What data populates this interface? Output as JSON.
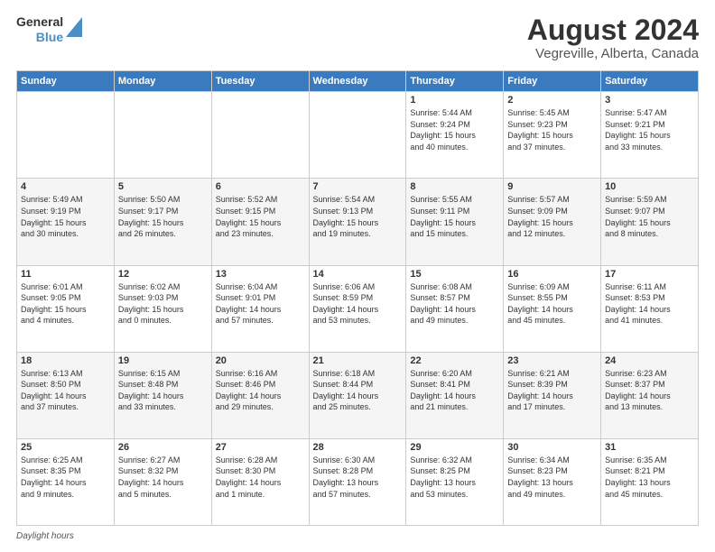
{
  "header": {
    "logo_line1": "General",
    "logo_line2": "Blue",
    "title": "August 2024",
    "subtitle": "Vegreville, Alberta, Canada"
  },
  "weekdays": [
    "Sunday",
    "Monday",
    "Tuesday",
    "Wednesday",
    "Thursday",
    "Friday",
    "Saturday"
  ],
  "weeks": [
    [
      {
        "day": "",
        "info": ""
      },
      {
        "day": "",
        "info": ""
      },
      {
        "day": "",
        "info": ""
      },
      {
        "day": "",
        "info": ""
      },
      {
        "day": "1",
        "info": "Sunrise: 5:44 AM\nSunset: 9:24 PM\nDaylight: 15 hours\nand 40 minutes."
      },
      {
        "day": "2",
        "info": "Sunrise: 5:45 AM\nSunset: 9:23 PM\nDaylight: 15 hours\nand 37 minutes."
      },
      {
        "day": "3",
        "info": "Sunrise: 5:47 AM\nSunset: 9:21 PM\nDaylight: 15 hours\nand 33 minutes."
      }
    ],
    [
      {
        "day": "4",
        "info": "Sunrise: 5:49 AM\nSunset: 9:19 PM\nDaylight: 15 hours\nand 30 minutes."
      },
      {
        "day": "5",
        "info": "Sunrise: 5:50 AM\nSunset: 9:17 PM\nDaylight: 15 hours\nand 26 minutes."
      },
      {
        "day": "6",
        "info": "Sunrise: 5:52 AM\nSunset: 9:15 PM\nDaylight: 15 hours\nand 23 minutes."
      },
      {
        "day": "7",
        "info": "Sunrise: 5:54 AM\nSunset: 9:13 PM\nDaylight: 15 hours\nand 19 minutes."
      },
      {
        "day": "8",
        "info": "Sunrise: 5:55 AM\nSunset: 9:11 PM\nDaylight: 15 hours\nand 15 minutes."
      },
      {
        "day": "9",
        "info": "Sunrise: 5:57 AM\nSunset: 9:09 PM\nDaylight: 15 hours\nand 12 minutes."
      },
      {
        "day": "10",
        "info": "Sunrise: 5:59 AM\nSunset: 9:07 PM\nDaylight: 15 hours\nand 8 minutes."
      }
    ],
    [
      {
        "day": "11",
        "info": "Sunrise: 6:01 AM\nSunset: 9:05 PM\nDaylight: 15 hours\nand 4 minutes."
      },
      {
        "day": "12",
        "info": "Sunrise: 6:02 AM\nSunset: 9:03 PM\nDaylight: 15 hours\nand 0 minutes."
      },
      {
        "day": "13",
        "info": "Sunrise: 6:04 AM\nSunset: 9:01 PM\nDaylight: 14 hours\nand 57 minutes."
      },
      {
        "day": "14",
        "info": "Sunrise: 6:06 AM\nSunset: 8:59 PM\nDaylight: 14 hours\nand 53 minutes."
      },
      {
        "day": "15",
        "info": "Sunrise: 6:08 AM\nSunset: 8:57 PM\nDaylight: 14 hours\nand 49 minutes."
      },
      {
        "day": "16",
        "info": "Sunrise: 6:09 AM\nSunset: 8:55 PM\nDaylight: 14 hours\nand 45 minutes."
      },
      {
        "day": "17",
        "info": "Sunrise: 6:11 AM\nSunset: 8:53 PM\nDaylight: 14 hours\nand 41 minutes."
      }
    ],
    [
      {
        "day": "18",
        "info": "Sunrise: 6:13 AM\nSunset: 8:50 PM\nDaylight: 14 hours\nand 37 minutes."
      },
      {
        "day": "19",
        "info": "Sunrise: 6:15 AM\nSunset: 8:48 PM\nDaylight: 14 hours\nand 33 minutes."
      },
      {
        "day": "20",
        "info": "Sunrise: 6:16 AM\nSunset: 8:46 PM\nDaylight: 14 hours\nand 29 minutes."
      },
      {
        "day": "21",
        "info": "Sunrise: 6:18 AM\nSunset: 8:44 PM\nDaylight: 14 hours\nand 25 minutes."
      },
      {
        "day": "22",
        "info": "Sunrise: 6:20 AM\nSunset: 8:41 PM\nDaylight: 14 hours\nand 21 minutes."
      },
      {
        "day": "23",
        "info": "Sunrise: 6:21 AM\nSunset: 8:39 PM\nDaylight: 14 hours\nand 17 minutes."
      },
      {
        "day": "24",
        "info": "Sunrise: 6:23 AM\nSunset: 8:37 PM\nDaylight: 14 hours\nand 13 minutes."
      }
    ],
    [
      {
        "day": "25",
        "info": "Sunrise: 6:25 AM\nSunset: 8:35 PM\nDaylight: 14 hours\nand 9 minutes."
      },
      {
        "day": "26",
        "info": "Sunrise: 6:27 AM\nSunset: 8:32 PM\nDaylight: 14 hours\nand 5 minutes."
      },
      {
        "day": "27",
        "info": "Sunrise: 6:28 AM\nSunset: 8:30 PM\nDaylight: 14 hours\nand 1 minute."
      },
      {
        "day": "28",
        "info": "Sunrise: 6:30 AM\nSunset: 8:28 PM\nDaylight: 13 hours\nand 57 minutes."
      },
      {
        "day": "29",
        "info": "Sunrise: 6:32 AM\nSunset: 8:25 PM\nDaylight: 13 hours\nand 53 minutes."
      },
      {
        "day": "30",
        "info": "Sunrise: 6:34 AM\nSunset: 8:23 PM\nDaylight: 13 hours\nand 49 minutes."
      },
      {
        "day": "31",
        "info": "Sunrise: 6:35 AM\nSunset: 8:21 PM\nDaylight: 13 hours\nand 45 minutes."
      }
    ]
  ],
  "footer": {
    "label": "Daylight hours"
  }
}
